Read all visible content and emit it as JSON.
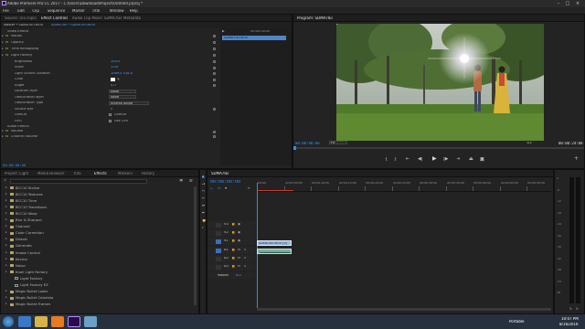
{
  "app": {
    "title": "Adobe Premiere Pro CC 2017 - C:\\Users\\Download\\Project\\Untitled.prproj *",
    "menus": [
      "File",
      "Edit",
      "Clip",
      "Sequence",
      "Marker",
      "Title",
      "Window",
      "Help"
    ]
  },
  "effect_controls": {
    "tabs": [
      "Source: (no clips)",
      "Effect Controls",
      "Audio Clip Mixer: SDMA7IEI",
      "Metadata"
    ],
    "active_tab": 1,
    "master_label": "Master * SDMA7IEI.MOV",
    "sequence_label": "SDMA7IEI * SDMA7IEI.MOV",
    "section_video": "Video Effects",
    "fx": [
      {
        "name": "Motion",
        "indent": 1
      },
      {
        "name": "Opacity",
        "indent": 1
      },
      {
        "name": "Time Remapping",
        "indent": 1
      },
      {
        "name": "Light Factory",
        "indent": 1
      }
    ],
    "params": [
      {
        "name": "Brightness",
        "value": "100.0"
      },
      {
        "name": "Scale",
        "value": "1.00"
      },
      {
        "name": "Light Source Location",
        "value": "1069.0   516.0"
      },
      {
        "name": "Color",
        "value": ""
      },
      {
        "name": "Angle",
        "value": "0.0"
      },
      {
        "name": "Location layer",
        "value": "None"
      },
      {
        "name": "Obscuration layer",
        "value": "None"
      },
      {
        "name": "Obscuration Type",
        "value": "Inverse Alpha"
      },
      {
        "name": "Source size",
        "value": "0"
      },
      {
        "name": "Unmult",
        "value": "Unmult"
      },
      {
        "name": "GPU",
        "value": "Use GPU"
      }
    ],
    "section_audio": "Audio Effects",
    "audio_fx": [
      "Volume",
      "Channel Volume"
    ],
    "ruler_time": "00:00:16:00",
    "clip_label": "SDMA7IEI.MOV",
    "current_time": "00:00:00:00"
  },
  "program": {
    "tab": "Program: SDMA7IEI",
    "timecode": "00:00:00:00",
    "fit": "Fit",
    "ratio": "1/2",
    "duration": "00:00:24:08"
  },
  "project": {
    "tabs": [
      "Project: Light",
      "Media Browser",
      "Info",
      "Effects",
      "Markers",
      "History"
    ],
    "active_tab": 3,
    "items": [
      {
        "label": "BCC10 Stylize",
        "indent": 1
      },
      {
        "label": "BCC10 Textures",
        "indent": 1
      },
      {
        "label": "BCC10 Time",
        "indent": 1
      },
      {
        "label": "BCC10 Transitions",
        "indent": 1
      },
      {
        "label": "BCC10 Warp",
        "indent": 1
      },
      {
        "label": "Blur & Sharpen",
        "indent": 1
      },
      {
        "label": "Channel",
        "indent": 1
      },
      {
        "label": "Color Correction",
        "indent": 1
      },
      {
        "label": "Distort",
        "indent": 1
      },
      {
        "label": "Generate",
        "indent": 1
      },
      {
        "label": "Image Control",
        "indent": 1
      },
      {
        "label": "Keying",
        "indent": 1
      },
      {
        "label": "Noise",
        "indent": 1
      },
      {
        "label": "Knoll Light Factory",
        "indent": 1
      },
      {
        "label": "Light Factory",
        "indent": 2
      },
      {
        "label": "Light Factory EZ",
        "indent": 2
      },
      {
        "label": "Magic Bullet Looks",
        "indent": 1
      },
      {
        "label": "Magic Bullet Colorista",
        "indent": 1
      },
      {
        "label": "Magic Bullet Frames",
        "indent": 1
      }
    ]
  },
  "timeline": {
    "tab": "SDMA7IEI",
    "timecode": "00:00:00:00",
    "ruler": [
      "00:00",
      "00:00:05:00",
      "00:00:10:00",
      "00:00:15:00",
      "00:00:20:00",
      "00:00:25:00",
      "00:00:30:00",
      "00:00:35:00",
      "00:00:40:00",
      "00:00:45:00",
      "00:00:50:00"
    ],
    "tracks": [
      "V3",
      "V2",
      "V1",
      "A1",
      "A2",
      "A3"
    ],
    "master_label": "Master",
    "master_value": "0.0",
    "video_clip": "SDMA7IEI.MOV [V]",
    "audio_clip": "",
    "meter_labels": [
      "0",
      "-6",
      "-12",
      "-18",
      "-24",
      "-30",
      "-36",
      "-42",
      "-48",
      "-54",
      "dB"
    ]
  },
  "taskbar": {
    "lang": "Portable",
    "time": "10:07 PM",
    "date": "8/16/2016"
  },
  "colors": {
    "accent": "#2f8cff",
    "clip_blue": "#9bb8df",
    "timeline_red": "#c23a2f"
  }
}
